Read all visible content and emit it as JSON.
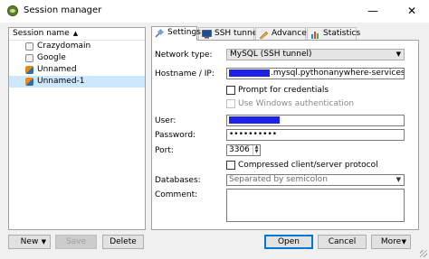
{
  "window": {
    "title": "Session manager",
    "minimize": "—",
    "close": "✕"
  },
  "sidebar": {
    "header": "Session name",
    "sort_arrow": "▲",
    "sessions": [
      {
        "label": "Crazydomain",
        "icon": "session-icon"
      },
      {
        "label": "Google",
        "icon": "session-icon"
      },
      {
        "label": "Unnamed",
        "icon": "mysql-session-icon"
      },
      {
        "label": "Unnamed-1",
        "icon": "mysql-session-icon",
        "selected": true
      }
    ]
  },
  "tabs": [
    {
      "label": "Settings",
      "icon": "plug-icon",
      "active": true
    },
    {
      "label": "SSH tunnel",
      "icon": "monitor-icon"
    },
    {
      "label": "Advanced",
      "icon": "pencil-icon"
    },
    {
      "label": "Statistics",
      "icon": "bar-chart-icon"
    }
  ],
  "settings": {
    "network_type_label": "Network type:",
    "network_type_value": "MySQL (SSH tunnel)",
    "hostname_label": "Hostname / IP:",
    "hostname_suffix": ".mysql.pythonanywhere-services.com",
    "prompt_credentials_label": "Prompt for credentials",
    "prompt_credentials_checked": false,
    "windows_auth_label": "Use Windows authentication",
    "windows_auth_checked": false,
    "user_label": "User:",
    "password_label": "Password:",
    "password_value": "••••••••••",
    "port_label": "Port:",
    "port_value": "3306",
    "compressed_label": "Compressed client/server protocol",
    "compressed_checked": false,
    "databases_label": "Databases:",
    "databases_placeholder": "Separated by semicolon",
    "comment_label": "Comment:",
    "comment_value": ""
  },
  "buttons": {
    "new": "New",
    "save": "Save",
    "delete": "Delete",
    "open": "Open",
    "cancel": "Cancel",
    "more": "More"
  },
  "colors": {
    "redaction": "#1e22e8",
    "selection": "#cce8ff",
    "focus_border": "#0078d7"
  }
}
